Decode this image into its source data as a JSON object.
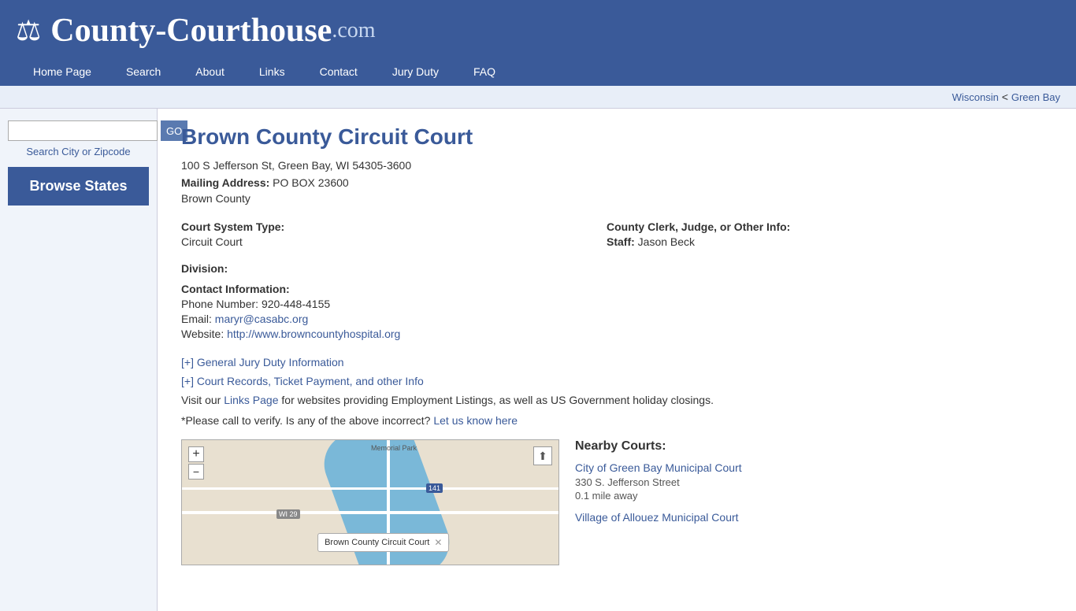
{
  "site": {
    "logo_main": "County-Courthouse",
    "logo_com": ".com",
    "logo_icon": "⚖"
  },
  "nav": {
    "items": [
      {
        "label": "Home Page",
        "id": "home"
      },
      {
        "label": "Search",
        "id": "search"
      },
      {
        "label": "About",
        "id": "about"
      },
      {
        "label": "Links",
        "id": "links"
      },
      {
        "label": "Contact",
        "id": "contact"
      },
      {
        "label": "Jury Duty",
        "id": "jury-duty"
      },
      {
        "label": "FAQ",
        "id": "faq"
      }
    ]
  },
  "breadcrumb": {
    "state": "Wisconsin",
    "city": "Green Bay",
    "separator": " < "
  },
  "sidebar": {
    "search_placeholder": "",
    "search_label": "Search City or Zipcode",
    "go_button": "GO",
    "browse_states": "Browse States"
  },
  "court": {
    "title": "Brown County Circuit Court",
    "address": "100 S Jefferson St, Green Bay, WI 54305-3600",
    "mailing_label": "Mailing Address:",
    "mailing_address": "PO BOX 23600",
    "county": "Brown County",
    "court_system_label": "Court System Type:",
    "court_system_value": "Circuit Court",
    "clerk_label": "County Clerk, Judge, or Other Info:",
    "staff_label": "Staff:",
    "staff_value": "Jason Beck",
    "division_label": "Division:",
    "division_value": "",
    "contact_label": "Contact Information:",
    "phone_label": "Phone Number:",
    "phone_value": "920-448-4155",
    "email_label": "Email:",
    "email_value": "maryr@casabc.org",
    "website_label": "Website:",
    "website_value": "http://www.browncountyhospital.org",
    "jury_link": "[+] General Jury Duty Information",
    "records_link": "[+] Court Records, Ticket Payment, and other Info",
    "links_note_prefix": "Visit our ",
    "links_page_label": "Links Page",
    "links_note_suffix": " for websites providing Employment Listings, as well as US Government holiday closings.",
    "verify_note": "*Please call to verify. Is any of the above incorrect? ",
    "let_us_know": "Let us know here"
  },
  "map": {
    "popup_label": "Brown County Circuit Court",
    "zoom_plus": "+",
    "zoom_minus": "−",
    "park_label": "Memorial Park",
    "road_badge": "141",
    "road_badge2": "WI 29"
  },
  "nearby": {
    "title": "Nearby Courts:",
    "courts": [
      {
        "name": "City of Green Bay Municipal Court",
        "address": "330 S. Jefferson Street",
        "distance": "0.1 mile away"
      },
      {
        "name": "Village of Allouez Municipal Court",
        "address": "",
        "distance": ""
      }
    ]
  }
}
